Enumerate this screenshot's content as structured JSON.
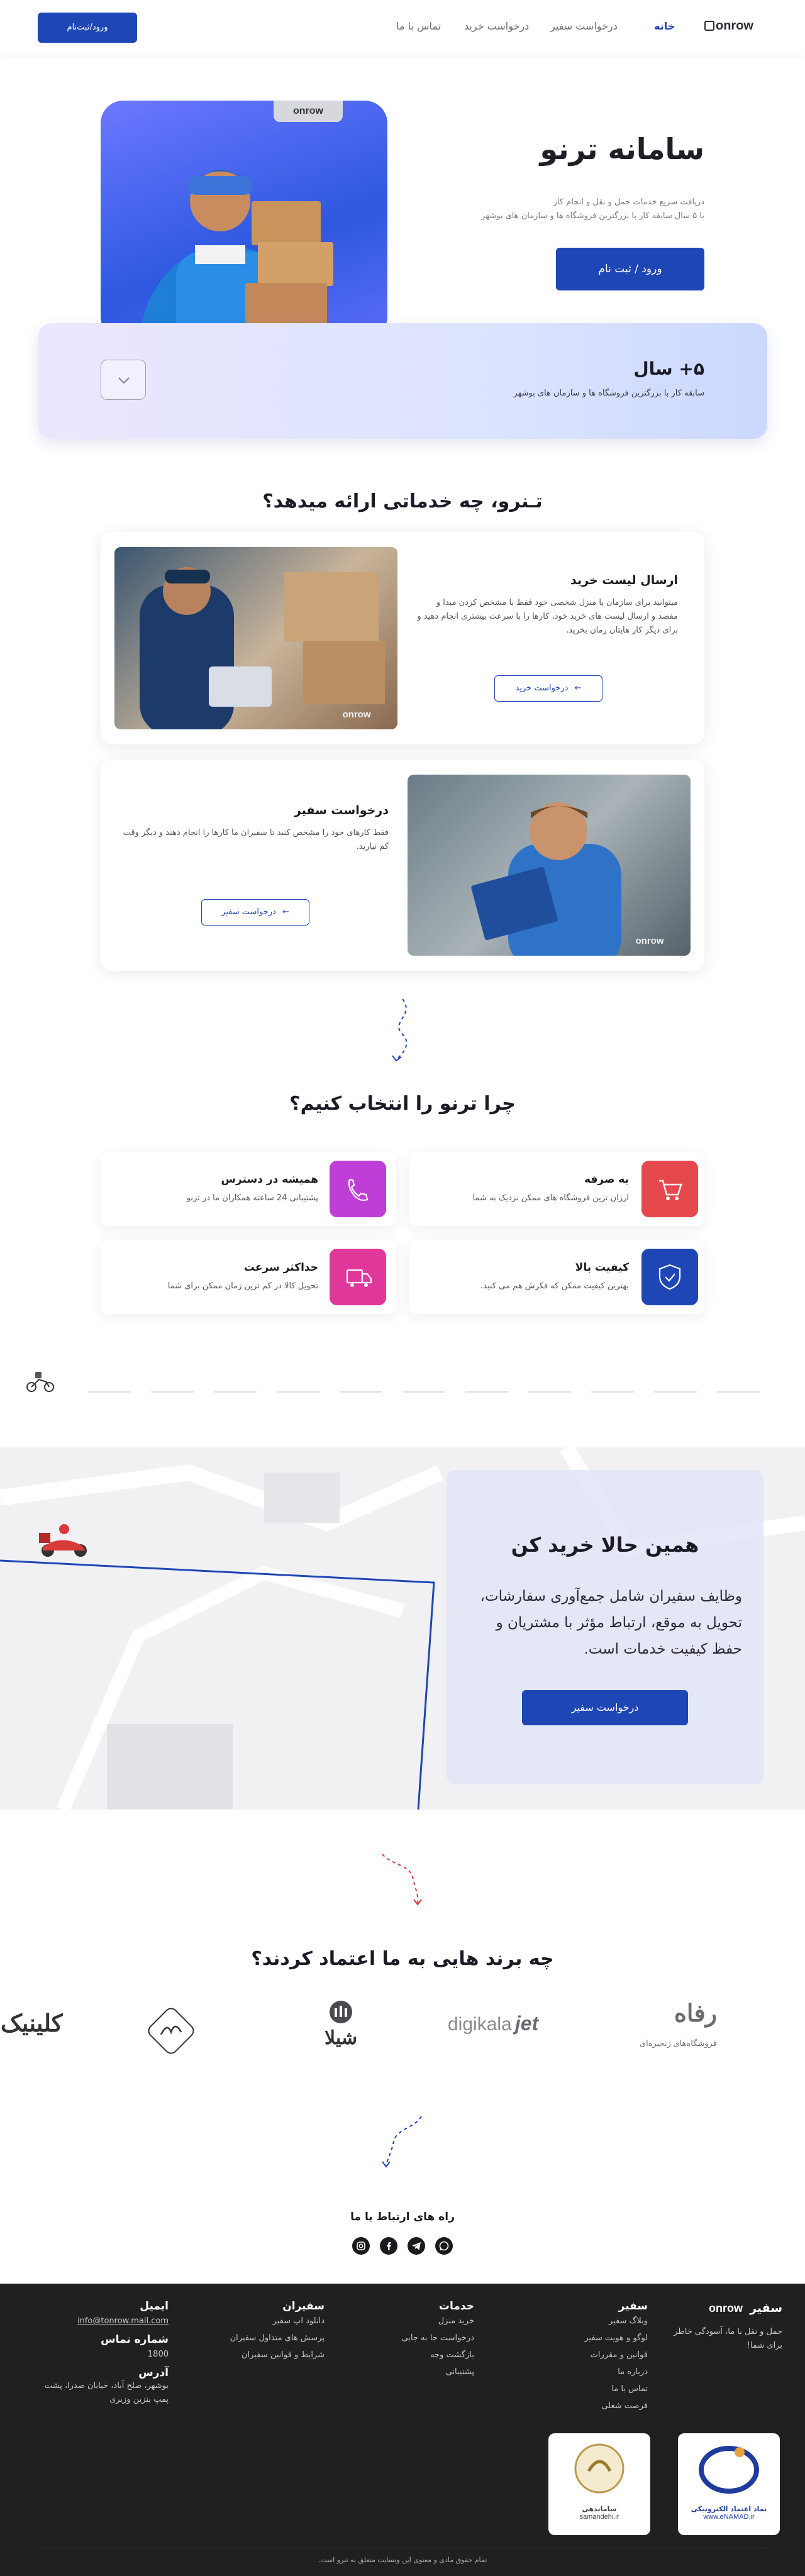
{
  "header": {
    "logo": "onrow",
    "nav": [
      "خانه",
      "درخواست سفیر",
      "درخواست خرید",
      "تماس با ما"
    ],
    "login_button": "ورود/ثبت‌نام"
  },
  "hero": {
    "title": "سامانه ترنو",
    "subtitle_line1": "دریافت سریع خدمات حمل و نقل و انجام کار",
    "subtitle_line2": "با ۵ سال سابقه کار با بزرگترین فروشگاه ها و سازمان های بوشهر",
    "cta": "ورود / ثبت نام",
    "photo_badge": "onrow"
  },
  "stats": {
    "value": "۵+ سال",
    "caption": "سابقه کار با بزرگترین فروشگاه ها و سازمان های بوشهر"
  },
  "services": {
    "title": "تـنرو، چه خدماتی ارائه میدهد؟",
    "items": [
      {
        "title": "ارسال لیست خرید",
        "desc": "میتوانید برای سازمان یا منزل شخصی خود فقط با مشخص کردن مبدا و مقصد و ارسال لیست های خرید خود، کارها را با سرعت بیشتری انجام دهید و برای دیگر کار هایتان زمان بخرید.",
        "button": "درخواست خرید",
        "photo_badge": "onrow"
      },
      {
        "title": "درخواست سفیر",
        "desc": "فقط کارهای خود را مشخص کنید تا سفیران ما کارها را انجام دهند و دیگر وقت کم نیارید.",
        "button": "درخواست سفیر",
        "photo_badge": "onrow"
      }
    ]
  },
  "why": {
    "title": "چرا ترنو را انتخاب کنیم؟",
    "items": [
      {
        "title": "به صرفه",
        "desc": "ارزان ترین فروشگاه های ممکن نزدیک به شما",
        "icon": "cart-icon",
        "color": "#e5484d"
      },
      {
        "title": "همیشه در دسترس",
        "desc": "پشتیبانی 24 ساعته همکاران ما در ترنو",
        "icon": "phone-icon",
        "color": "#c03ed8"
      },
      {
        "title": "کیفیت بالا",
        "desc": "بهترین کیفیت ممکن که فکرش هم می کنید.",
        "icon": "shield-check-icon",
        "color": "#1f46b5"
      },
      {
        "title": "حداکثر سرعت",
        "desc": "تحویل کالا در کم ترین زمان ممکن برای شما",
        "icon": "delivery-icon",
        "color": "#e0379b"
      }
    ]
  },
  "promo": {
    "title": "همین حالا خرید کن",
    "text": "وظایف سفیران شامل جمع‌آوری سفارشات، تحویل به موقع، ارتباط مؤثر با مشتریان و حفظ کیفیت خدمات است.",
    "button": "درخواست سفیر"
  },
  "brands": {
    "title": "چه برند هایی به ما اعتماد کردند؟",
    "items": [
      "رفاه",
      "فروشگاه‌های زنجیره‌ای",
      "digikala",
      "jet",
      "شیلا",
      "کلینیک"
    ]
  },
  "contact": {
    "title": "راه های ارتباط با ما",
    "icons": [
      "whatsapp-icon",
      "telegram-icon",
      "facebook-icon",
      "instagram-icon"
    ]
  },
  "footer": {
    "brand_title": "سفیر",
    "logo": "onrow",
    "brand_desc": "حمل و نقل با ما، آسودگی خاطر برای شما!",
    "columns": [
      {
        "title": "سفیر",
        "links": [
          "وبلاگ سفیر",
          "لوگو و هویت سفیر",
          "قوانین و مقررات",
          "درباره ما",
          "تماس با ما",
          "فرصت شغلی"
        ]
      },
      {
        "title": "خدمات",
        "links": [
          "خرید منزل",
          "درخواست جا به جایی",
          "بازگشت وجه",
          "پشتیبانی"
        ]
      },
      {
        "title": "سفیران",
        "links": [
          "دانلود اپ سفیر",
          "پرسش های متداول سفیران",
          "شرایط و قوانین سفیران"
        ]
      }
    ],
    "email_label": "ایمیل",
    "email": "info@tonrow.mail.com",
    "phone_label": "شماره تماس",
    "phone": "1800",
    "address_label": "آدرس",
    "address": "بوشهر، صلح آباد، خیابان صدرا، پشت پمپ بنزین وزیری",
    "badge1_caption": "www.eNAMAD.ir",
    "badge1_title": "نماد اعتماد الکترونیکی",
    "badge2_caption": "samandehi.ir",
    "badge2_title": "ساماندهی",
    "copyright": "تمام حقوق مادی و معنوی این وبسایت متعلق به تنرو است."
  }
}
